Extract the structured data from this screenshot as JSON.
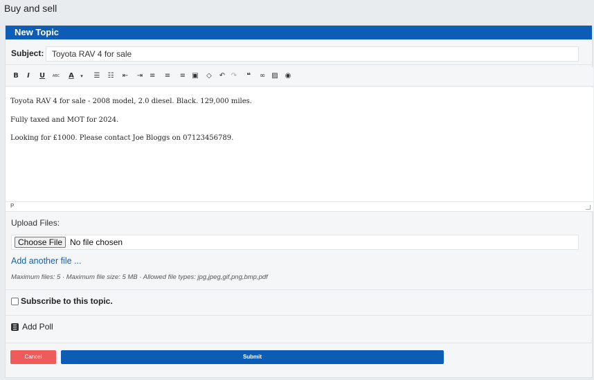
{
  "forum": {
    "title": "Buy and sell"
  },
  "panel": {
    "header": "New Topic"
  },
  "subject": {
    "label": "Subject:",
    "value": "Toyota RAV 4 for sale"
  },
  "toolbar": {
    "buttons": [
      {
        "name": "bold-icon",
        "glyph": "B"
      },
      {
        "name": "italic-icon",
        "glyph": "I"
      },
      {
        "name": "underline-icon",
        "glyph": "U"
      },
      {
        "name": "strikethrough-icon",
        "glyph": "ABC"
      },
      {
        "name": "font-color-icon",
        "glyph": "A"
      },
      {
        "name": "bullet-list-icon",
        "glyph": "☰"
      },
      {
        "name": "numbered-list-icon",
        "glyph": "☷"
      },
      {
        "name": "outdent-icon",
        "glyph": "⇤"
      },
      {
        "name": "indent-icon",
        "glyph": "⇥"
      },
      {
        "name": "align-left-icon",
        "glyph": "≡"
      },
      {
        "name": "align-center-icon",
        "glyph": "≡"
      },
      {
        "name": "align-right-icon",
        "glyph": "≡"
      },
      {
        "name": "paste-icon",
        "glyph": "▣"
      },
      {
        "name": "eraser-icon",
        "glyph": "◇"
      },
      {
        "name": "undo-icon",
        "glyph": "↶"
      },
      {
        "name": "redo-icon",
        "glyph": "↷"
      },
      {
        "name": "quote-icon",
        "glyph": "❝"
      },
      {
        "name": "link-icon",
        "glyph": "∞"
      },
      {
        "name": "image-icon",
        "glyph": "▨"
      },
      {
        "name": "preview-icon",
        "glyph": "◉"
      }
    ]
  },
  "editor": {
    "lines": [
      "Toyota RAV 4 for sale - 2008 model, 2.0 diesel. Black. 129,000 miles.",
      "Fully taxed and MOT for 2024.",
      "Looking for £1000. Please contact Joe Bloggs on 07123456789."
    ],
    "status": "P"
  },
  "upload": {
    "label": "Upload Files:",
    "choose_label": "Choose File",
    "no_file": "No file chosen",
    "add_another": "Add another file ...",
    "limits": "Maximum files: 5 · Maximum file size: 5 MB · Allowed file types: jpg,jpeg,gif,png,bmp,pdf"
  },
  "subscribe": {
    "label": "Subscribe to this topic.",
    "checked": false
  },
  "poll": {
    "label": "Add Poll"
  },
  "actions": {
    "cancel": "Cancel",
    "submit": "Submit"
  },
  "colors": {
    "primary": "#0d5db6",
    "danger": "#ef5a5a",
    "link": "#1a5fa8"
  }
}
